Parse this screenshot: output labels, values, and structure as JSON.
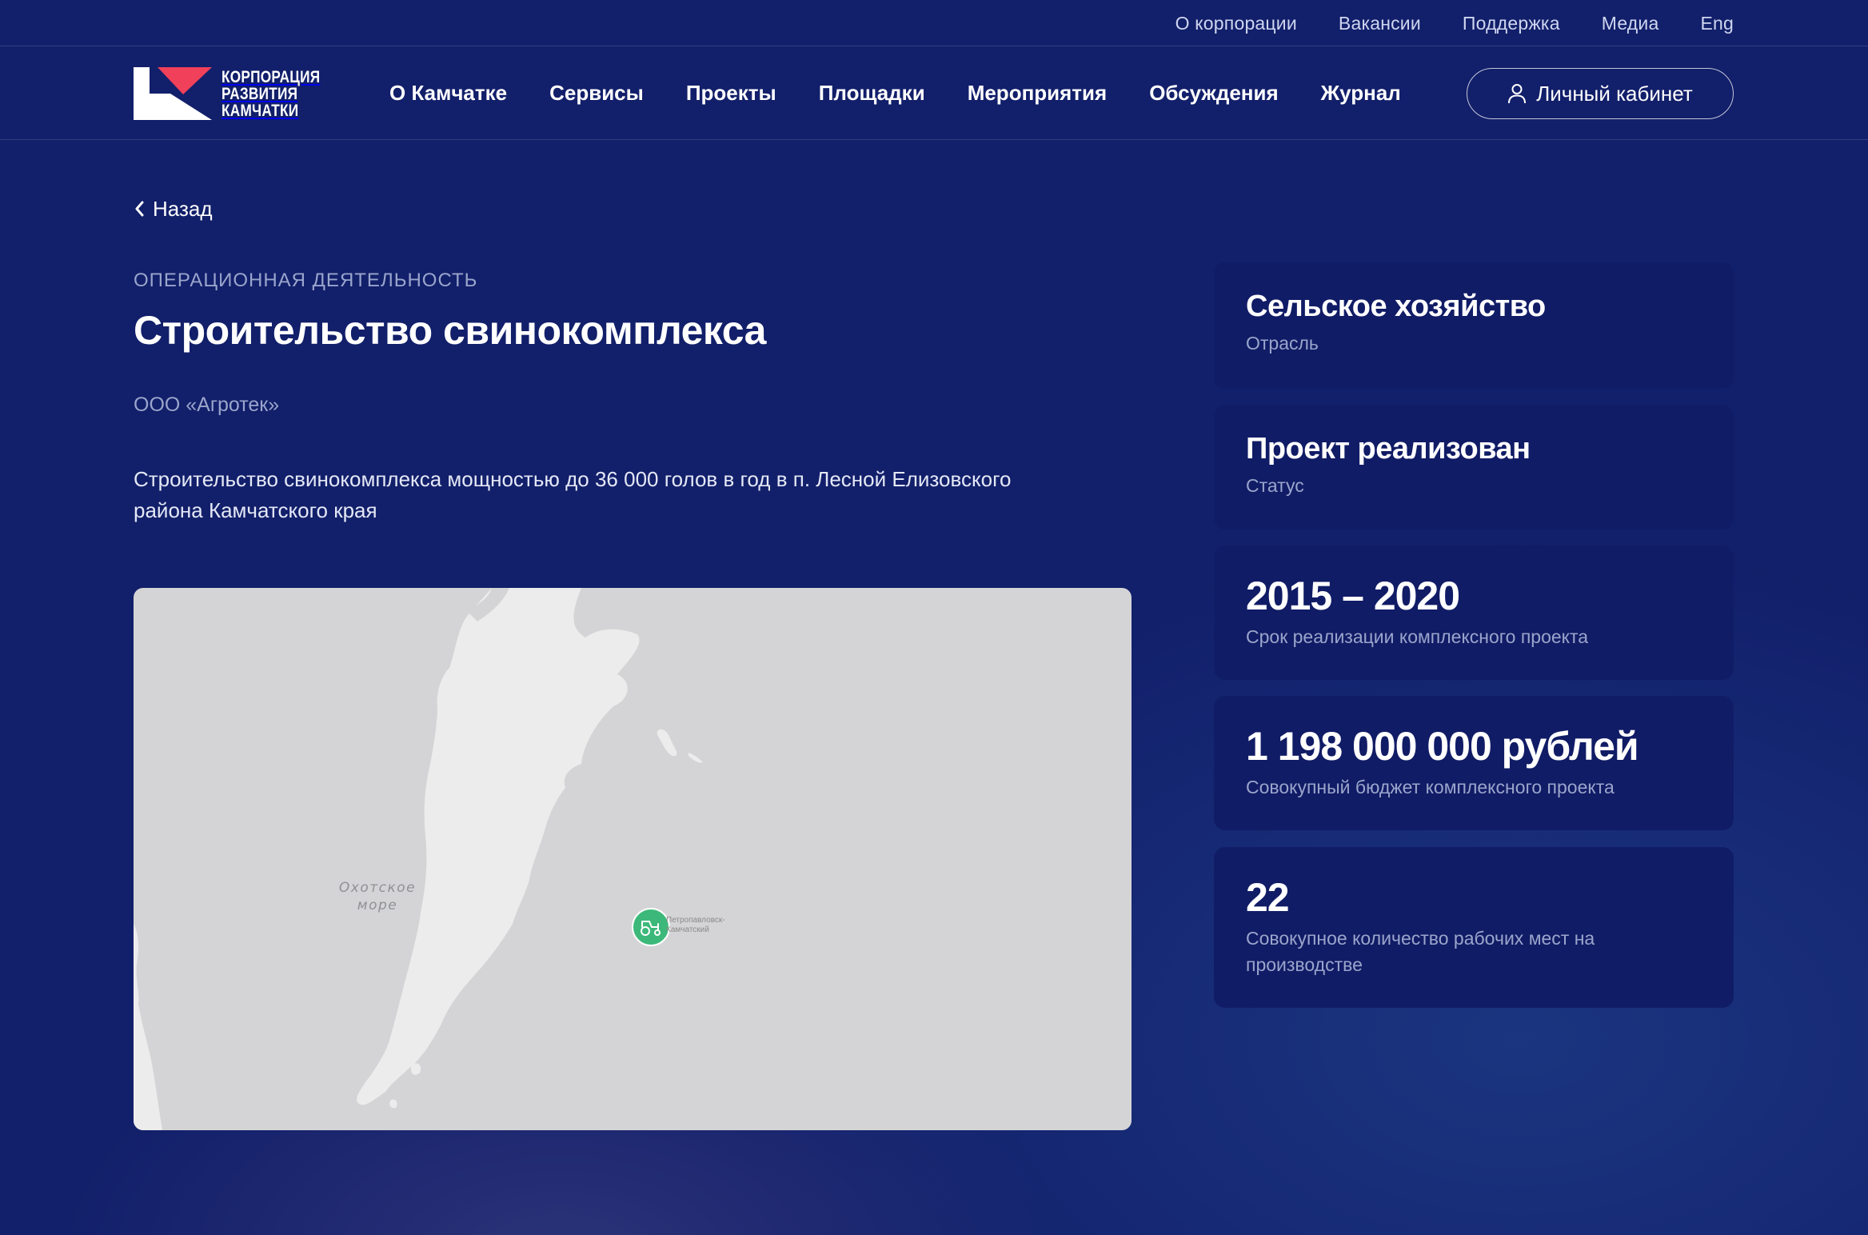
{
  "topbar": {
    "links": [
      "О корпорации",
      "Вакансии",
      "Поддержка",
      "Медиа",
      "Eng"
    ]
  },
  "logo": {
    "lines": [
      "КОРПОРАЦИЯ",
      "РАЗВИТИЯ",
      "КАМЧАТКИ"
    ],
    "colors": {
      "white": "#ffffff",
      "accent": "#f0405a"
    }
  },
  "nav": {
    "items": [
      "О Камчатке",
      "Сервисы",
      "Проекты",
      "Площадки",
      "Мероприятия",
      "Обсуждения",
      "Журнал"
    ],
    "cabinet_label": "Личный кабинет",
    "cabinet_icon": "user-icon"
  },
  "page": {
    "back_label": "Назад",
    "category": "ОПЕРАЦИОННАЯ ДЕЯТЕЛЬНОСТЬ",
    "title": "Строительство свинокомплекса",
    "company": "ООО «Агротек»",
    "description": "Строительство свинокомплекса мощностью до 36 000 голов в год в п. Лесной Елизовского района Камчатского края"
  },
  "map": {
    "sea_label": "Охотское море",
    "city_label": "Петропавловск-Камчатский",
    "marker_icon": "tractor-icon",
    "marker_color": "#3cb97a"
  },
  "cards": [
    {
      "value": "Сельское хозяйство",
      "caption": "Отрасль"
    },
    {
      "value": "Проект реализован",
      "caption": "Статус"
    },
    {
      "value": "2015 – 2020",
      "caption": "Срок реализации комплексного проекта"
    },
    {
      "value": "1 198 000 000 рублей",
      "caption": "Совокупный бюджет комплексного проекта"
    },
    {
      "value": "22",
      "caption": "Совокупное количество рабочих мест на производстве"
    }
  ],
  "colors": {
    "background": "#121f6a",
    "card": "#111c66",
    "muted_text": "#9aa5cc"
  }
}
